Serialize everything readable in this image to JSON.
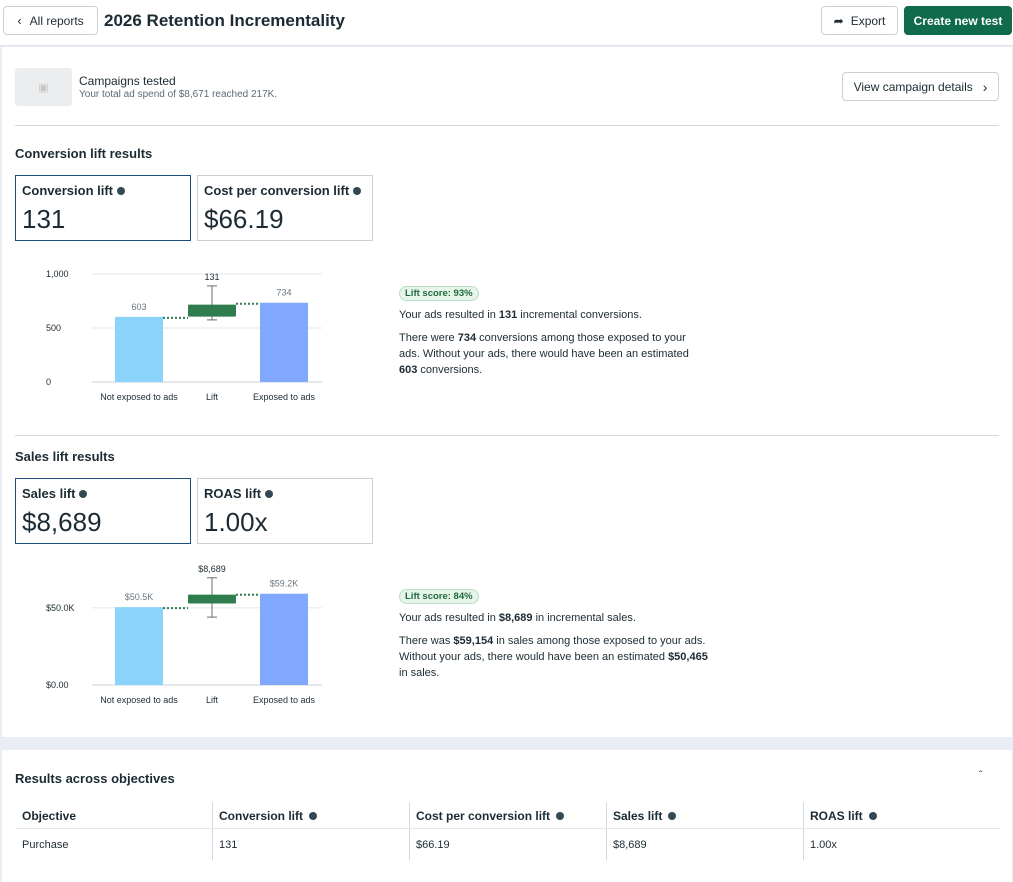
{
  "header": {
    "back_label": "All reports",
    "title": "2026 Retention Incrementality",
    "export_label": "Export",
    "create_label": "Create new test"
  },
  "campaigns": {
    "title": "Campaigns tested",
    "subtitle": "Your total ad spend of $8,671 reached 217K.",
    "view_details_label": "View campaign details"
  },
  "conversion": {
    "section_title": "Conversion lift results",
    "cards": [
      {
        "label": "Conversion lift",
        "value": "131"
      },
      {
        "label": "Cost per conversion lift",
        "value": "$66.19"
      }
    ],
    "badge": "Lift score: 93%",
    "line1_pre": "Your ads resulted in ",
    "line1_bold": "131",
    "line1_post": " incremental conversions.",
    "line2_pre": "There were ",
    "line2_bold1": "734",
    "line2_mid": " conversions among those exposed to your ads. Without your ads, there would have been an estimated ",
    "line2_bold2": "603",
    "line2_post": " conversions."
  },
  "sales": {
    "section_title": "Sales lift results",
    "cards": [
      {
        "label": "Sales lift",
        "value": "$8,689"
      },
      {
        "label": "ROAS lift",
        "value": "1.00x"
      }
    ],
    "badge": "Lift score: 84%",
    "line1_pre": "Your ads resulted in ",
    "line1_bold": "$8,689",
    "line1_post": " in incremental sales.",
    "line2_pre": "There was ",
    "line2_bold1": "$59,154",
    "line2_mid": " in sales among those exposed to your ads. Without your ads, there would have been an estimated ",
    "line2_bold2": "$50,465",
    "line2_post": " in sales."
  },
  "chart_data": [
    {
      "type": "bar",
      "categories": [
        "Not exposed to ads",
        "Lift",
        "Exposed to ads"
      ],
      "values": [
        603,
        131,
        734
      ],
      "data_labels": [
        "603",
        "131",
        "734"
      ],
      "yticks": [
        "1,000",
        "500",
        "0"
      ],
      "ylim": [
        0,
        1000
      ],
      "lift_range": [
        605,
        717
      ],
      "lift_whisker": [
        575,
        890
      ],
      "colors": {
        "not_exposed": "#8ad4fb",
        "lift": "#2f7d4f",
        "exposed": "#80a8ff"
      }
    },
    {
      "type": "bar",
      "categories": [
        "Not exposed to ads",
        "Lift",
        "Exposed to ads"
      ],
      "values": [
        50465,
        8689,
        59154
      ],
      "data_labels": [
        "$50.5K",
        "$8,689",
        "$59.2K"
      ],
      "yticks": [
        "$50.0K",
        "$0.00"
      ],
      "ylim": [
        0,
        70000
      ],
      "lift_range": [
        52800,
        58600
      ],
      "lift_whisker": [
        44000,
        69500
      ],
      "colors": {
        "not_exposed": "#8ad4fb",
        "lift": "#2f7d4f",
        "exposed": "#80a8ff"
      }
    }
  ],
  "results_table": {
    "title": "Results across objectives",
    "columns": [
      "Objective",
      "Conversion lift",
      "Cost per conversion lift",
      "Sales lift",
      "ROAS lift"
    ],
    "rows": [
      [
        "Purchase",
        "131",
        "$66.19",
        "$8,689",
        "1.00x"
      ]
    ]
  }
}
